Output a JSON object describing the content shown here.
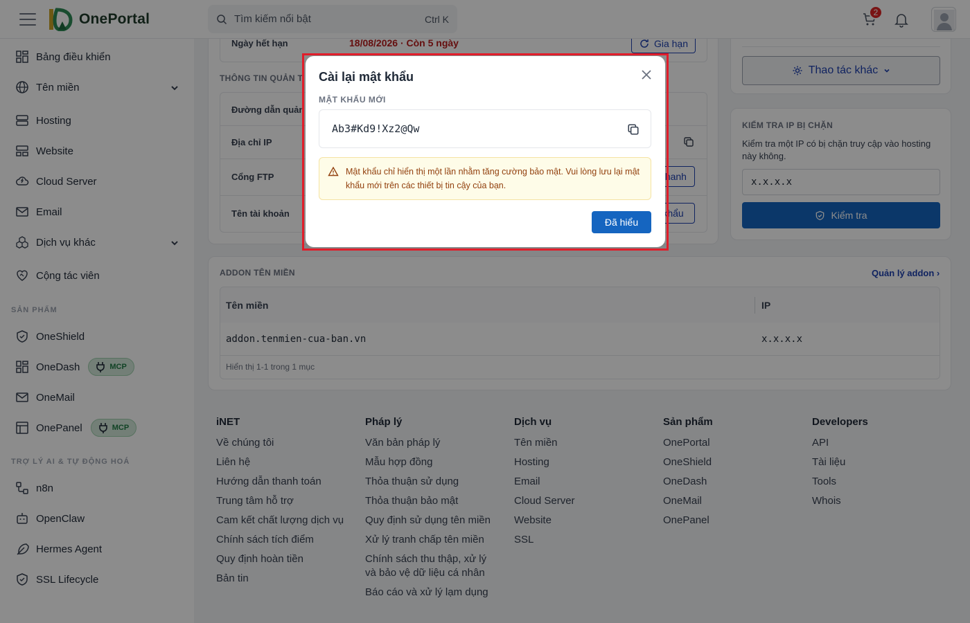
{
  "header": {
    "brand": "OnePortal",
    "search_placeholder": "Tìm kiếm nổi bật",
    "search_shortcut": "Ctrl K",
    "cart_count": "2"
  },
  "sidebar": {
    "items": [
      {
        "label": "Bảng điều khiển"
      },
      {
        "label": "Tên miền"
      },
      {
        "label": "Hosting"
      },
      {
        "label": "Website"
      },
      {
        "label": "Cloud Server"
      },
      {
        "label": "Email"
      },
      {
        "label": "Dịch vụ khác"
      },
      {
        "label": "Cộng tác viên"
      }
    ],
    "products_title": "SẢN PHẨM",
    "products": [
      {
        "label": "OneShield"
      },
      {
        "label": "OneDash",
        "badge": "MCP"
      },
      {
        "label": "OneMail"
      },
      {
        "label": "OnePanel",
        "badge": "MCP"
      }
    ],
    "ai_title": "TRỢ LÝ AI & TỰ ĐỘNG HOÁ",
    "ai_items": [
      {
        "label": "n8n"
      },
      {
        "label": "OpenClaw"
      },
      {
        "label": "Hermes Agent"
      },
      {
        "label": "SSL Lifecycle"
      }
    ]
  },
  "main": {
    "expiry_label": "Ngày hết hạn",
    "expiry_value": "18/08/2026 · Còn 5 ngày",
    "renew_button": "Gia hạn",
    "mgmt_title": "THÔNG TIN QUẢN T",
    "rows": [
      {
        "label": "Đường dẫn quản"
      },
      {
        "label": "Địa chỉ IP"
      },
      {
        "label": "Cổng FTP",
        "button": "nhanh"
      },
      {
        "label": "Tên tài khoản",
        "button": "khẩu"
      }
    ],
    "other_actions": "Thao tác khác",
    "ip_check": {
      "title": "KIỂM TRA IP BỊ CHẶN",
      "desc": "Kiểm tra một IP có bị chặn truy cập vào hosting này không.",
      "input_value": "x.x.x.x",
      "button": "Kiểm tra"
    },
    "addon": {
      "title": "ADDON TÊN MIỀN",
      "manage_link": "Quản lý addon ›",
      "columns": [
        "Tên miền",
        "IP"
      ],
      "rows": [
        {
          "domain": "addon.tenmien-cua-ban.vn",
          "ip": "x.x.x.x"
        }
      ],
      "footer": "Hiển thị 1-1 trong 1 mục"
    }
  },
  "footer": {
    "columns": [
      {
        "title": "iNET",
        "links": [
          "Về chúng tôi",
          "Liên hệ",
          "Hướng dẫn thanh toán",
          "Trung tâm hỗ trợ",
          "Cam kết chất lượng dịch vụ",
          "Chính sách tích điểm",
          "Quy định hoàn tiền",
          "Bản tin"
        ]
      },
      {
        "title": "Pháp lý",
        "links": [
          "Văn bản pháp lý",
          "Mẫu hợp đồng",
          "Thỏa thuận sử dụng",
          "Thỏa thuận bảo mật",
          "Quy định sử dụng tên miền",
          "Xử lý tranh chấp tên miền",
          "Chính sách thu thập, xử lý và bảo vệ dữ liệu cá nhân",
          "Báo cáo và xử lý lạm dụng"
        ]
      },
      {
        "title": "Dịch vụ",
        "links": [
          "Tên miền",
          "Hosting",
          "Email",
          "Cloud Server",
          "Website",
          "SSL"
        ]
      },
      {
        "title": "Sản phẩm",
        "links": [
          "OnePortal",
          "OneShield",
          "OneDash",
          "OneMail",
          "OnePanel"
        ]
      },
      {
        "title": "Developers",
        "links": [
          "API",
          "Tài liệu",
          "Tools",
          "Whois"
        ]
      }
    ]
  },
  "dialog": {
    "title": "Cài lại mật khẩu",
    "field_label": "MẬT KHẨU MỚI",
    "password": "Ab3#Kd9!Xz2@Qw",
    "warning": "Mật khẩu chỉ hiển thị một lần nhằm tăng cường bảo mật. Vui lòng lưu lại mật khẩu mới trên các thiết bị tin cậy của bạn.",
    "confirm_button": "Đã hiểu"
  },
  "colors": {
    "primary": "#1565c0",
    "danger": "#dc2626",
    "highlight_frame": "#e11d2a"
  }
}
